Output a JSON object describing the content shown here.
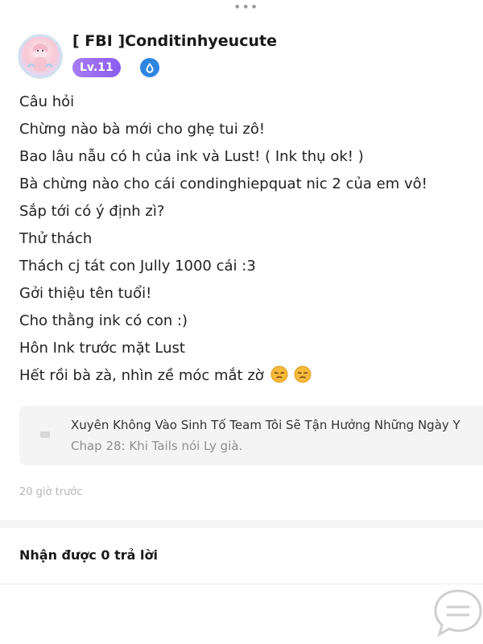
{
  "header": {
    "more_icon": "more-dots-icon",
    "more_glyph": "•••"
  },
  "author": {
    "username": "[ FBI ]Conditinhyeucute",
    "level": "Lv.11",
    "verify_icon": "verified-drop-icon",
    "avatar_icon": "user-avatar"
  },
  "post": {
    "lines": [
      "Câu hỏi",
      "Chừng nào bà mới cho ghẹ tui zô!",
      "Bao lâu nẫu có h của ink và Lust! ( Ink thụ ok! )",
      "Bà chừng nào cho cái condinghiepquat nic 2 của em vô!",
      "Sắp tới có ý định zì?",
      "Thử thách",
      "Thách cj tát con Jully 1000 cái :3",
      "Gởi thiệu tên tuổi!",
      "Cho thằng ink có con :)",
      "Hôn Ink trước mặt Lust",
      "Hết rồi bà zà, nhìn zề móc mắt zờ"
    ],
    "emoji_icon": "unamused-face-emoji"
  },
  "linked_story": {
    "title": "Xuyên Không Vào Sinh Tố Team Tôi Sẽ Tận Hưởng Những Ngày Y",
    "chapter": "Chap 28: Khi Tails nói Ly già.",
    "icon": "story-thumbnail-icon"
  },
  "meta": {
    "timestamp": "20 giờ trước"
  },
  "replies": {
    "count_label": "Nhận được 0 trả lời"
  },
  "fab": {
    "icon": "comment-bubble-icon"
  },
  "colors": {
    "accent_purple": "#8a5cf0",
    "verify_blue": "#2f86e0",
    "muted_text": "#8f8f8f",
    "card_bg": "#f4f4f4"
  }
}
